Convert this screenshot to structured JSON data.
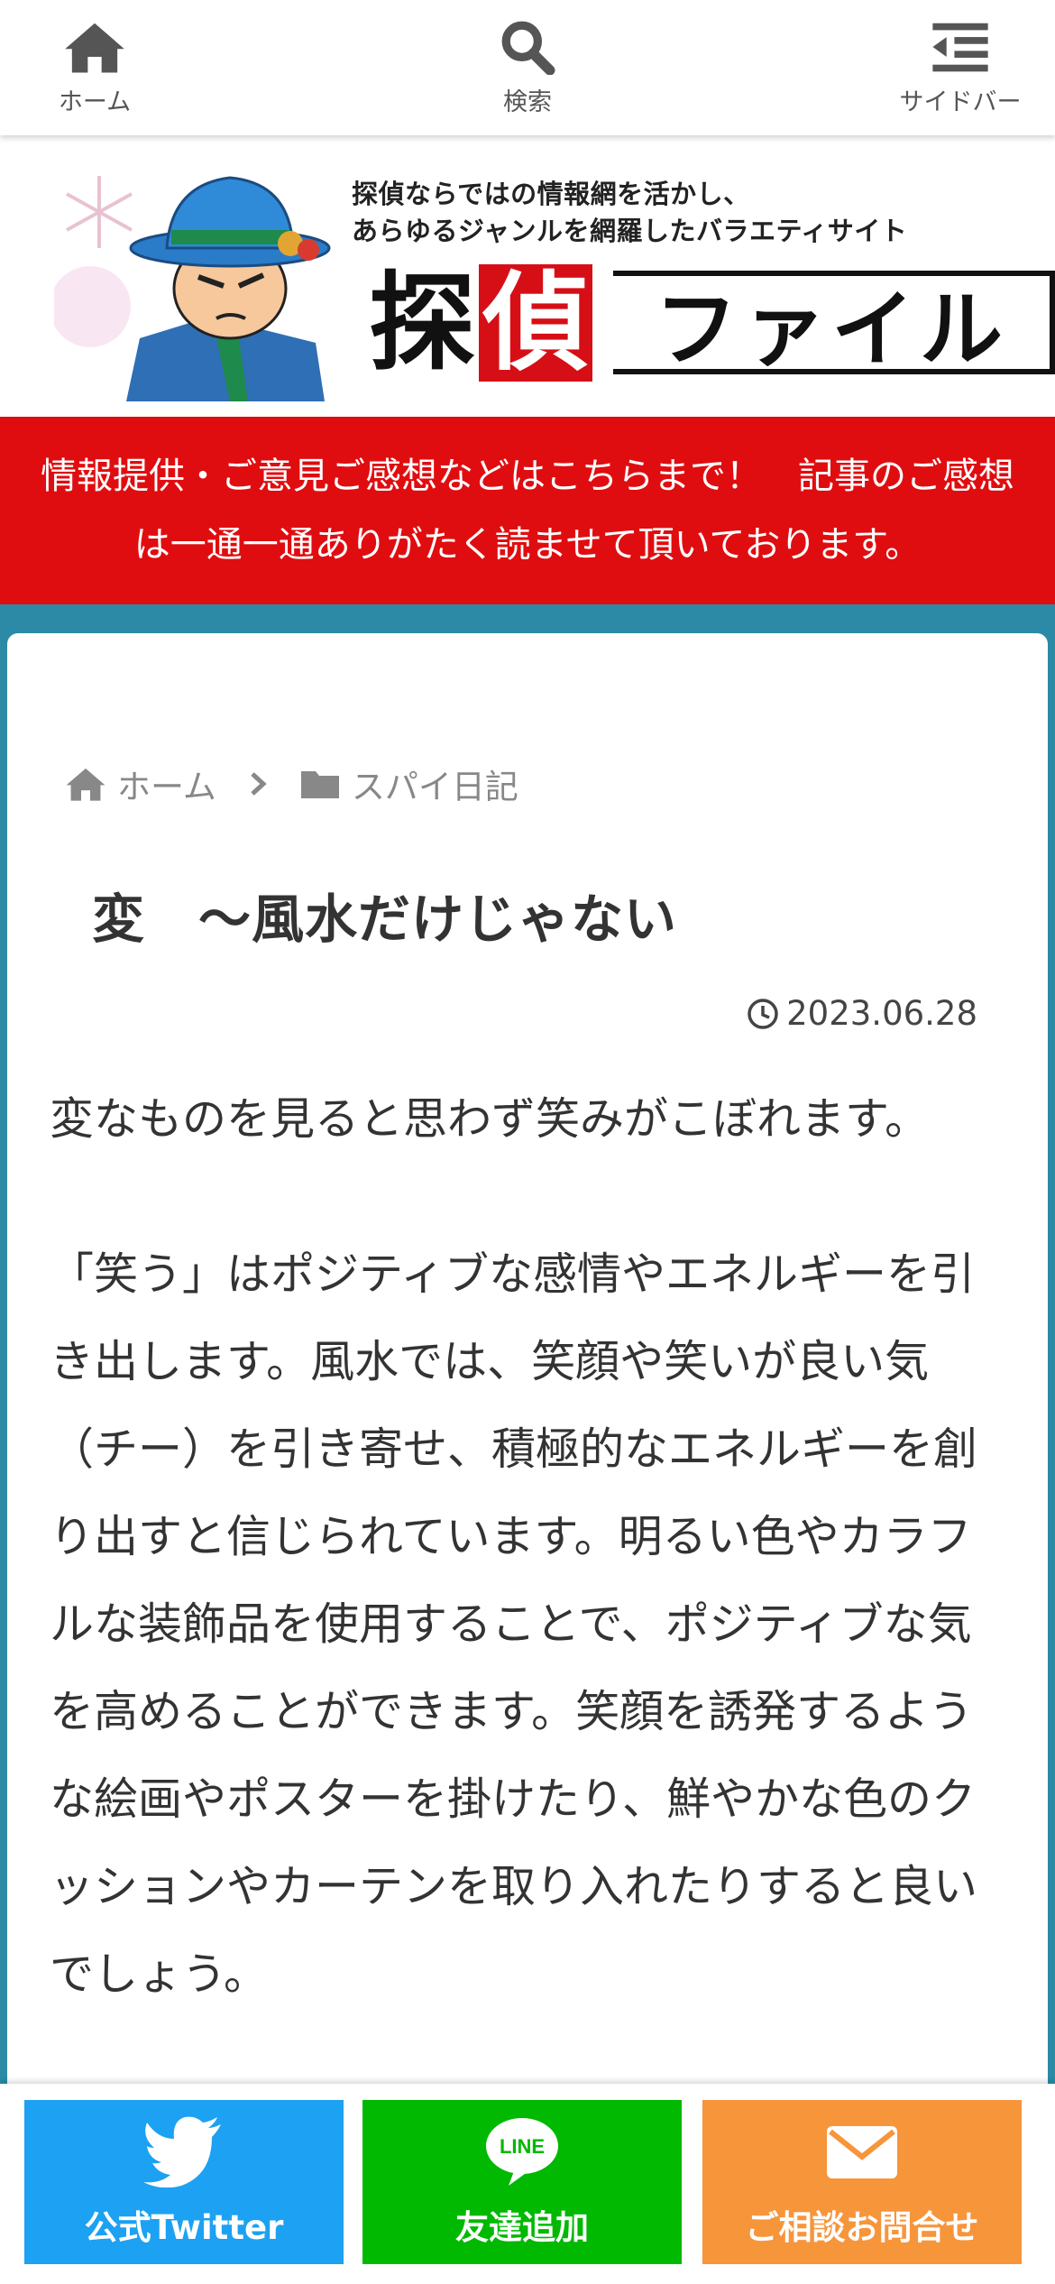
{
  "nav": {
    "home": "ホーム",
    "search": "検索",
    "sidebar": "サイドバー"
  },
  "header": {
    "tagline_line1": "探偵ならではの情報網を活かし、",
    "tagline_line2": "あらゆるジャンルを網羅したバラエティサイト",
    "logo_char1": "探",
    "logo_char2": "偵",
    "logo_rest": "ファイル"
  },
  "notice": {
    "text": "情報提供・ご意見ご感想などはこちらまで！　記事のご感想は一通一通ありがたく読ませて頂いております。"
  },
  "breadcrumb": {
    "home": "ホーム",
    "category": "スパイ日記"
  },
  "article": {
    "title": "変　～風水だけじゃない",
    "date": "2023.06.28",
    "paragraph1": "変なものを見ると思わず笑みがこぼれます。",
    "paragraph2": "「笑う」はポジティブな感情やエネルギーを引き出します。風水では、笑顔や笑いが良い気（チー）を引き寄せ、積極的なエネルギーを創り出すと信じられています。明るい色やカラフルな装飾品を使用することで、ポジティブな気を高めることができます。笑顔を誘発するような絵画やポスターを掛けたり、鮮やかな色のクッションやカーテンを取り入れたりすると良いでしょう。"
  },
  "bottombar": {
    "twitter": "公式Twitter",
    "line": "友達追加",
    "contact": "ご相談お問合せ"
  },
  "colors": {
    "background": "#2c8aa6",
    "notice_red": "#e00d10",
    "twitter_blue": "#1da1f2",
    "line_green": "#00b900",
    "contact_orange": "#f7953b"
  },
  "icons": {
    "home": "home-icon",
    "search": "search-icon",
    "sidebar": "sidebar-menu-icon",
    "folder": "folder-icon",
    "clock": "clock-icon",
    "twitter": "twitter-bird-icon",
    "line": "line-chat-icon",
    "mail": "envelope-icon"
  }
}
